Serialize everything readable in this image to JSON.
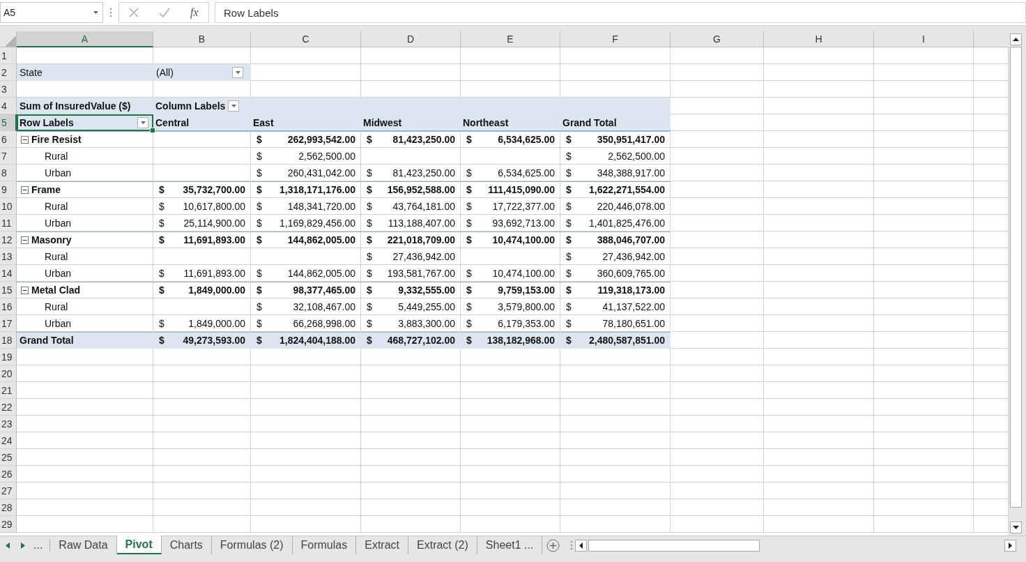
{
  "name_box": {
    "value": "A5"
  },
  "formula_bar": {
    "fx": "fx",
    "value": "Row Labels"
  },
  "columns": [
    {
      "label": "A",
      "selected": true
    },
    {
      "label": "B",
      "selected": false
    },
    {
      "label": "C",
      "selected": false
    },
    {
      "label": "D",
      "selected": false
    },
    {
      "label": "E",
      "selected": false
    },
    {
      "label": "F",
      "selected": false
    },
    {
      "label": "G",
      "selected": false
    },
    {
      "label": "H",
      "selected": false
    },
    {
      "label": "I",
      "selected": false
    }
  ],
  "row_numbers": [
    {
      "label": "1",
      "selected": false
    },
    {
      "label": "2",
      "selected": false
    },
    {
      "label": "3",
      "selected": false
    },
    {
      "label": "4",
      "selected": false
    },
    {
      "label": "5",
      "selected": true
    },
    {
      "label": "6",
      "selected": false
    },
    {
      "label": "7",
      "selected": false
    },
    {
      "label": "8",
      "selected": false
    },
    {
      "label": "9",
      "selected": false
    },
    {
      "label": "10",
      "selected": false
    },
    {
      "label": "11",
      "selected": false
    },
    {
      "label": "12",
      "selected": false
    },
    {
      "label": "13",
      "selected": false
    },
    {
      "label": "14",
      "selected": false
    },
    {
      "label": "15",
      "selected": false
    },
    {
      "label": "16",
      "selected": false
    },
    {
      "label": "17",
      "selected": false
    },
    {
      "label": "18",
      "selected": false
    },
    {
      "label": "19",
      "selected": false
    },
    {
      "label": "20",
      "selected": false
    },
    {
      "label": "21",
      "selected": false
    },
    {
      "label": "22",
      "selected": false
    },
    {
      "label": "23",
      "selected": false
    },
    {
      "label": "24",
      "selected": false
    },
    {
      "label": "25",
      "selected": false
    },
    {
      "label": "26",
      "selected": false
    },
    {
      "label": "27",
      "selected": false
    },
    {
      "label": "28",
      "selected": false
    },
    {
      "label": "29",
      "selected": false
    }
  ],
  "filter": {
    "label": "State",
    "value": "(All)"
  },
  "pivot": {
    "value_label": "Sum of InsuredValue ($)",
    "column_labels": "Column Labels",
    "row_labels": "Row Labels",
    "column_headers": [
      "Central",
      "East",
      "Midwest",
      "Northeast",
      "Grand Total"
    ],
    "rows": [
      {
        "label": "Fire Resist",
        "expanded": true,
        "values": [
          {
            "kind": "blank"
          },
          {
            "symbol": "$",
            "amount": "262,993,542.00"
          },
          {
            "symbol": "$",
            "amount": "81,423,250.00"
          },
          {
            "symbol": "$",
            "amount": "6,534,625.00"
          },
          {
            "symbol": "$",
            "amount": "350,951,417.00"
          }
        ],
        "children": [
          {
            "label": "Rural",
            "values": [
              {
                "kind": "blank"
              },
              {
                "symbol": "$",
                "amount": "2,562,500.00"
              },
              {
                "kind": "blank"
              },
              {
                "kind": "blank"
              },
              {
                "symbol": "$",
                "amount": "2,562,500.00"
              }
            ]
          },
          {
            "label": "Urban",
            "values": [
              {
                "kind": "blank"
              },
              {
                "symbol": "$",
                "amount": "260,431,042.00"
              },
              {
                "symbol": "$",
                "amount": "81,423,250.00"
              },
              {
                "symbol": "$",
                "amount": "6,534,625.00"
              },
              {
                "symbol": "$",
                "amount": "348,388,917.00"
              }
            ]
          }
        ]
      },
      {
        "label": "Frame",
        "expanded": true,
        "values": [
          {
            "symbol": "$",
            "amount": "35,732,700.00"
          },
          {
            "symbol": "$",
            "amount": "1,318,171,176.00"
          },
          {
            "symbol": "$",
            "amount": "156,952,588.00"
          },
          {
            "symbol": "$",
            "amount": "111,415,090.00"
          },
          {
            "symbol": "$",
            "amount": "1,622,271,554.00"
          }
        ],
        "children": [
          {
            "label": "Rural",
            "values": [
              {
                "symbol": "$",
                "amount": "10,617,800.00"
              },
              {
                "symbol": "$",
                "amount": "148,341,720.00"
              },
              {
                "symbol": "$",
                "amount": "43,764,181.00"
              },
              {
                "symbol": "$",
                "amount": "17,722,377.00"
              },
              {
                "symbol": "$",
                "amount": "220,446,078.00"
              }
            ]
          },
          {
            "label": "Urban",
            "values": [
              {
                "symbol": "$",
                "amount": "25,114,900.00"
              },
              {
                "symbol": "$",
                "amount": "1,169,829,456.00"
              },
              {
                "symbol": "$",
                "amount": "113,188,407.00"
              },
              {
                "symbol": "$",
                "amount": "93,692,713.00"
              },
              {
                "symbol": "$",
                "amount": "1,401,825,476.00"
              }
            ]
          }
        ]
      },
      {
        "label": "Masonry",
        "expanded": true,
        "values": [
          {
            "symbol": "$",
            "amount": "11,691,893.00"
          },
          {
            "symbol": "$",
            "amount": "144,862,005.00"
          },
          {
            "symbol": "$",
            "amount": "221,018,709.00"
          },
          {
            "symbol": "$",
            "amount": "10,474,100.00"
          },
          {
            "symbol": "$",
            "amount": "388,046,707.00"
          }
        ],
        "children": [
          {
            "label": "Rural",
            "values": [
              {
                "kind": "blank"
              },
              {
                "kind": "blank"
              },
              {
                "symbol": "$",
                "amount": "27,436,942.00"
              },
              {
                "kind": "blank"
              },
              {
                "symbol": "$",
                "amount": "27,436,942.00"
              }
            ]
          },
          {
            "label": "Urban",
            "values": [
              {
                "symbol": "$",
                "amount": "11,691,893.00"
              },
              {
                "symbol": "$",
                "amount": "144,862,005.00"
              },
              {
                "symbol": "$",
                "amount": "193,581,767.00"
              },
              {
                "symbol": "$",
                "amount": "10,474,100.00"
              },
              {
                "symbol": "$",
                "amount": "360,609,765.00"
              }
            ]
          }
        ]
      },
      {
        "label": "Metal Clad",
        "expanded": true,
        "values": [
          {
            "symbol": "$",
            "amount": "1,849,000.00"
          },
          {
            "symbol": "$",
            "amount": "98,377,465.00"
          },
          {
            "symbol": "$",
            "amount": "9,332,555.00"
          },
          {
            "symbol": "$",
            "amount": "9,759,153.00"
          },
          {
            "symbol": "$",
            "amount": "119,318,173.00"
          }
        ],
        "children": [
          {
            "label": "Rural",
            "values": [
              {
                "kind": "blank"
              },
              {
                "symbol": "$",
                "amount": "32,108,467.00"
              },
              {
                "symbol": "$",
                "amount": "5,449,255.00"
              },
              {
                "symbol": "$",
                "amount": "3,579,800.00"
              },
              {
                "symbol": "$",
                "amount": "41,137,522.00"
              }
            ]
          },
          {
            "label": "Urban",
            "values": [
              {
                "symbol": "$",
                "amount": "1,849,000.00"
              },
              {
                "symbol": "$",
                "amount": "66,268,998.00"
              },
              {
                "symbol": "$",
                "amount": "3,883,300.00"
              },
              {
                "symbol": "$",
                "amount": "6,179,353.00"
              },
              {
                "symbol": "$",
                "amount": "78,180,651.00"
              }
            ]
          }
        ]
      }
    ],
    "grand_total": {
      "label": "Grand Total",
      "values": [
        {
          "symbol": "$",
          "amount": "49,273,593.00"
        },
        {
          "symbol": "$",
          "amount": "1,824,404,188.00"
        },
        {
          "symbol": "$",
          "amount": "468,727,102.00"
        },
        {
          "symbol": "$",
          "amount": "138,182,968.00"
        },
        {
          "symbol": "$",
          "amount": "2,480,587,851.00"
        }
      ]
    }
  },
  "sheet_nav": {
    "more": "..."
  },
  "sheet_tabs": [
    {
      "label": "Raw Data",
      "selected": false
    },
    {
      "label": "Pivot",
      "selected": true
    },
    {
      "label": "Charts",
      "selected": false
    },
    {
      "label": "Formulas (2)",
      "selected": false
    },
    {
      "label": "Formulas",
      "selected": false
    },
    {
      "label": "Extract",
      "selected": false
    },
    {
      "label": "Extract (2)",
      "selected": false
    },
    {
      "label": "Sheet1 ...",
      "selected": false
    }
  ]
}
